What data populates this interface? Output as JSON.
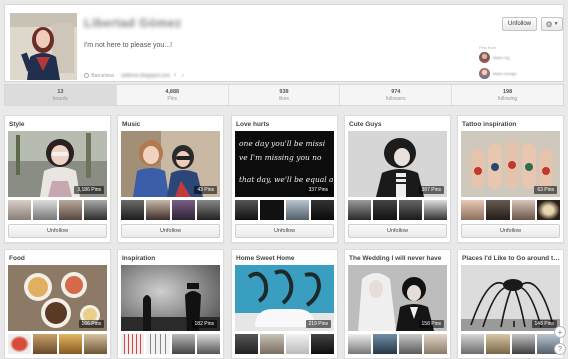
{
  "profile": {
    "name": "Libertad Gómez",
    "bio": "I'm not here to please you...!",
    "location": "Barcelona",
    "website": "address.blogspot.com",
    "pins_from_label": "Pins from",
    "pins_from": [
      "Mario Gg",
      "Mario Design"
    ],
    "unfollow_label": "Unfollow"
  },
  "stats": [
    {
      "num": "13",
      "label": "boards"
    },
    {
      "num": "4,888",
      "label": "Pins"
    },
    {
      "num": "938",
      "label": "likes"
    },
    {
      "num": "974",
      "label": "followers"
    },
    {
      "num": "198",
      "label": "following"
    }
  ],
  "boards": [
    {
      "title": "Style",
      "count": "3,186 Pins",
      "button": "Unfollow"
    },
    {
      "title": "Music",
      "count": "43 Pins",
      "button": "Unfollow"
    },
    {
      "title": "Love hurts",
      "count": "337 Pins",
      "button": "Unfollow"
    },
    {
      "title": "Cute Guys",
      "count": "387 Pins",
      "button": "Unfollow"
    },
    {
      "title": "Tattoo inspiration",
      "count": "63 Pins",
      "button": "Unfollow"
    },
    {
      "title": "Food",
      "count": "166 Pins"
    },
    {
      "title": "Inspiration",
      "count": "182 Pins"
    },
    {
      "title": "Home Sweet Home",
      "count": "219 Pins"
    },
    {
      "title": "The Wedding I will never have",
      "count": "158 Pins"
    },
    {
      "title": "Places I'd Like to Go around the world",
      "count": "148 Pins"
    }
  ],
  "love_hurts_lyrics": [
    "one day you'll be missi",
    "ve I'm missing you no",
    "that day, we'll be equal ag"
  ],
  "icons": {
    "gear": "gear-icon",
    "scroll_top": "plus-icon",
    "help": "help-icon",
    "location": "location-pin-icon",
    "social": "social-icons"
  },
  "colors": {
    "background": "#e9e9e9",
    "active_stat": "#dcdcdc",
    "card": "#ffffff"
  }
}
